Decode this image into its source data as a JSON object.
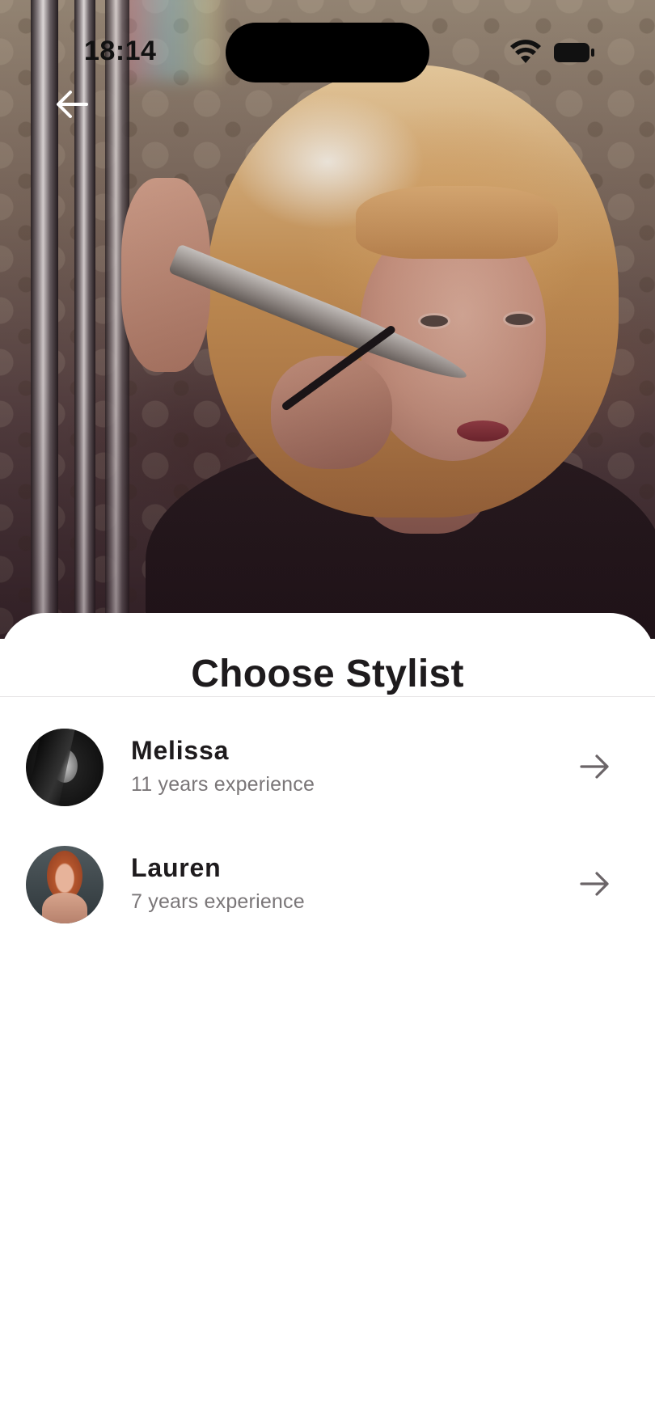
{
  "status_bar": {
    "time": "18:14",
    "icons": [
      "wifi-icon",
      "battery-icon"
    ]
  },
  "hero": {
    "back_icon": "arrow-left-icon"
  },
  "sheet": {
    "title": "Choose Stylist",
    "stylists": [
      {
        "name": "Melissa",
        "experience": "11 years experience",
        "icon": "arrow-right-icon"
      },
      {
        "name": "Lauren",
        "experience": "7 years experience",
        "icon": "arrow-right-icon"
      }
    ]
  },
  "colors": {
    "title_text": "#1e1b1d",
    "secondary_text": "#7a7678",
    "arrow": "#6b6568",
    "sheet_background": "#ffffff"
  }
}
